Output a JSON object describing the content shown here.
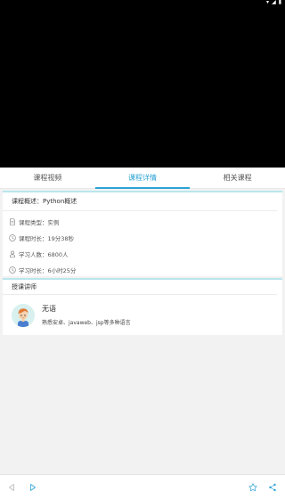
{
  "tabs": [
    {
      "label": "课程视频"
    },
    {
      "label": "课程详情"
    },
    {
      "label": "相关课程"
    }
  ],
  "details": {
    "summary": "课程概述：Python概述",
    "type": "课程类型：实例",
    "duration": "课程时长：19分38秒",
    "learners": "学习人数：6800人",
    "study_time": "学习时长：6小时25分"
  },
  "teacher": {
    "heading": "授课讲师",
    "name": "无语",
    "description": "熟悉安卓、javaweb、jsp等多种语言"
  },
  "icons": {
    "type": "document-icon",
    "duration": "clock-icon",
    "learners": "person-icon",
    "study_time": "clock-icon",
    "back": "back-arrow-icon",
    "forward": "forward-arrow-icon",
    "favorite": "star-icon",
    "share": "share-icon"
  },
  "colors": {
    "accent": "#2ba3d4",
    "card_border": "#b9e6ec",
    "background": "#f2f2f2"
  }
}
